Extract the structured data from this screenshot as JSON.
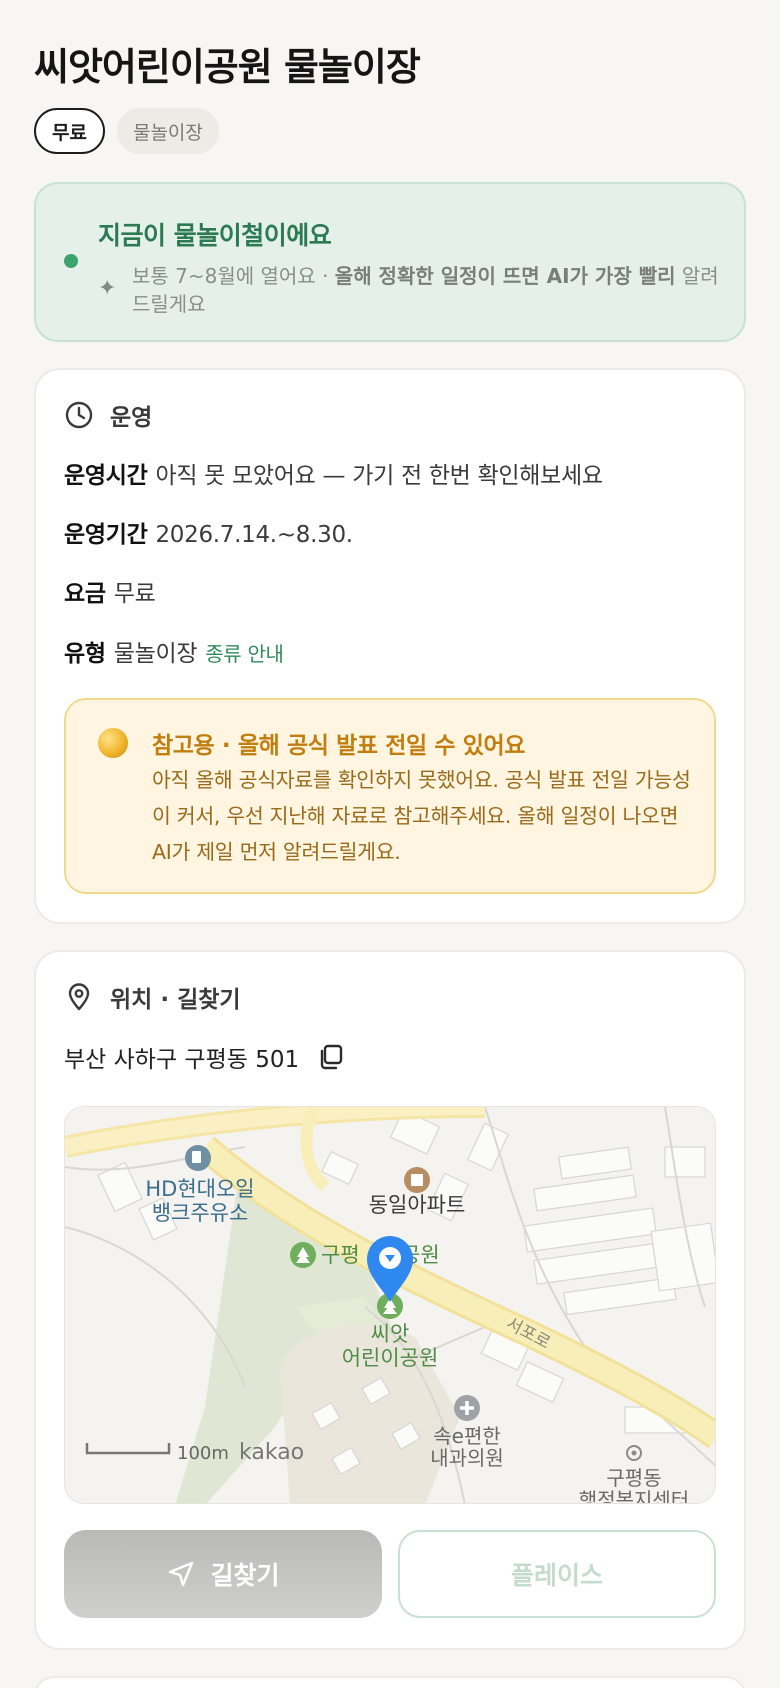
{
  "page": {
    "title": "씨앗어린이공원 물놀이장",
    "chips": {
      "fee": "무료",
      "type": "물놀이장"
    }
  },
  "season_banner": {
    "headline": "지금이 물놀이철이에요",
    "text_plain": "보통 7~8월에 열어요 · ",
    "text_bold": "올해 정확한 일정이 뜨면 AI가 가장 빨리",
    "text_plain_2": " 알려드릴게요"
  },
  "operation": {
    "section_label": "운영",
    "hours_key": "운영시간",
    "hours_value": "아직 못 모았어요 — 가기 전 한번 확인해보세요",
    "period_key": "운영기간",
    "period_value": "2026.7.14.~8.30.",
    "fee_key": "요금",
    "fee_value": "무료",
    "type_key": "유형",
    "type_value": "물놀이장",
    "type_link": "종류 안내",
    "notice": {
      "headline": "참고용 · 올해 공식 발표 전일 수 있어요",
      "body": "아직 올해 공식자료를 확인하지 못했어요. 공식 발표 전일 가능성이 커서, 우선 지난해 자료로 참고해주세요. 올해 일정이 나오면 AI가 제일 먼저 알려드릴게요."
    }
  },
  "location": {
    "section_label": "위치 · 길찾기",
    "address": "부산 사하구 구평동 501",
    "map": {
      "labels": {
        "gas_station": [
          "HD현대오일",
          "뱅크주유소"
        ],
        "apartment": "동일아파트",
        "park_upper": "구평",
        "park_upper_tail": "공원",
        "park_pin": [
          "씨앗",
          "어린이공원"
        ],
        "road": "서포로",
        "clinic": [
          "속e편한",
          "내과의원"
        ],
        "office": [
          "구평동",
          "행정복지센터"
        ],
        "scale": "100m",
        "brand": "kakao"
      }
    },
    "buttons": {
      "route": "길찾기",
      "place": "플레이스"
    }
  },
  "colors": {
    "accent_green": "#2b7a52",
    "notice_orange": "#c17d0e",
    "pin_blue": "#2f88ef"
  }
}
